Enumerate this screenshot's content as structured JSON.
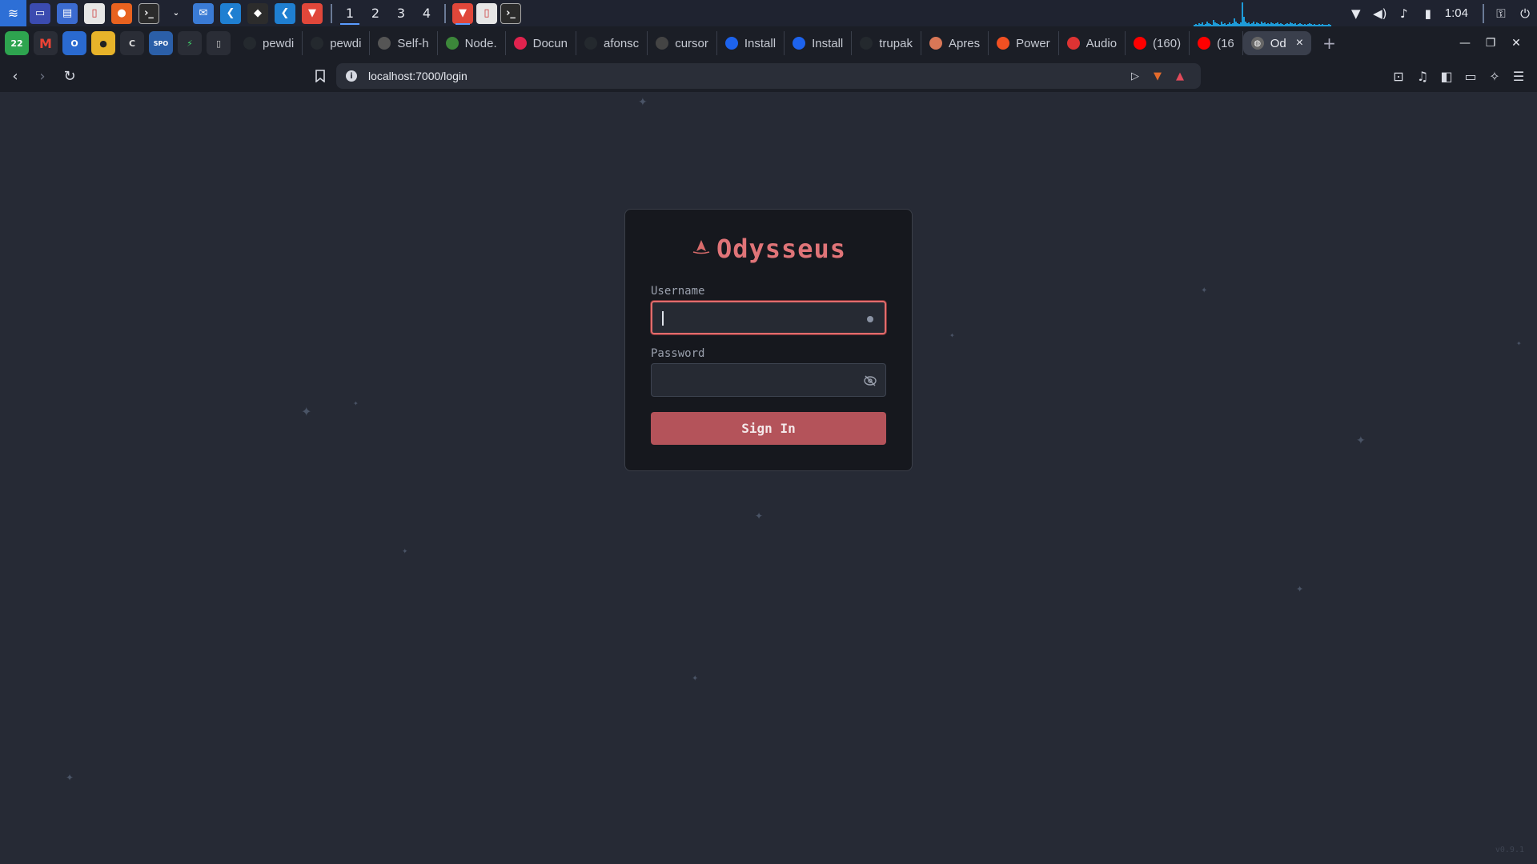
{
  "taskbar": {
    "workspaces": [
      "1",
      "2",
      "3",
      "4"
    ],
    "clock": "1:04"
  },
  "browser": {
    "tabs": [
      {
        "label": "pewdi",
        "icon": "github-icon"
      },
      {
        "label": "pewdi",
        "icon": "github-icon"
      },
      {
        "label": "Self-h",
        "icon": "openai-icon"
      },
      {
        "label": "Node.",
        "icon": "nodejs-icon"
      },
      {
        "label": "Docun",
        "icon": "nestjs-icon"
      },
      {
        "label": "afonsc",
        "icon": "github-icon"
      },
      {
        "label": "cursor",
        "icon": "cursor-icon"
      },
      {
        "label": "Install",
        "icon": "docker-icon"
      },
      {
        "label": "Install",
        "icon": "docker-icon"
      },
      {
        "label": "trupak",
        "icon": "github-icon"
      },
      {
        "label": "Apres",
        "icon": "claude-icon"
      },
      {
        "label": "Power",
        "icon": "microsoft-icon"
      },
      {
        "label": "Audio",
        "icon": "audio-icon"
      },
      {
        "label": "(160) ",
        "icon": "youtube-icon"
      },
      {
        "label": "(16",
        "icon": "youtube-icon"
      }
    ],
    "active_tab": {
      "label": "Od",
      "icon": "globe-icon"
    },
    "url": "localhost:7000/login",
    "pinned_badge": "22"
  },
  "login": {
    "app_name": "Odysseus",
    "username_label": "Username",
    "username_value": "",
    "password_label": "Password",
    "password_value": "",
    "submit_label": "Sign In",
    "version": "v0.9.1"
  },
  "colors": {
    "accent": "#e07478",
    "button": "#b4535a",
    "background": "#262a35",
    "card": "#16181e"
  }
}
